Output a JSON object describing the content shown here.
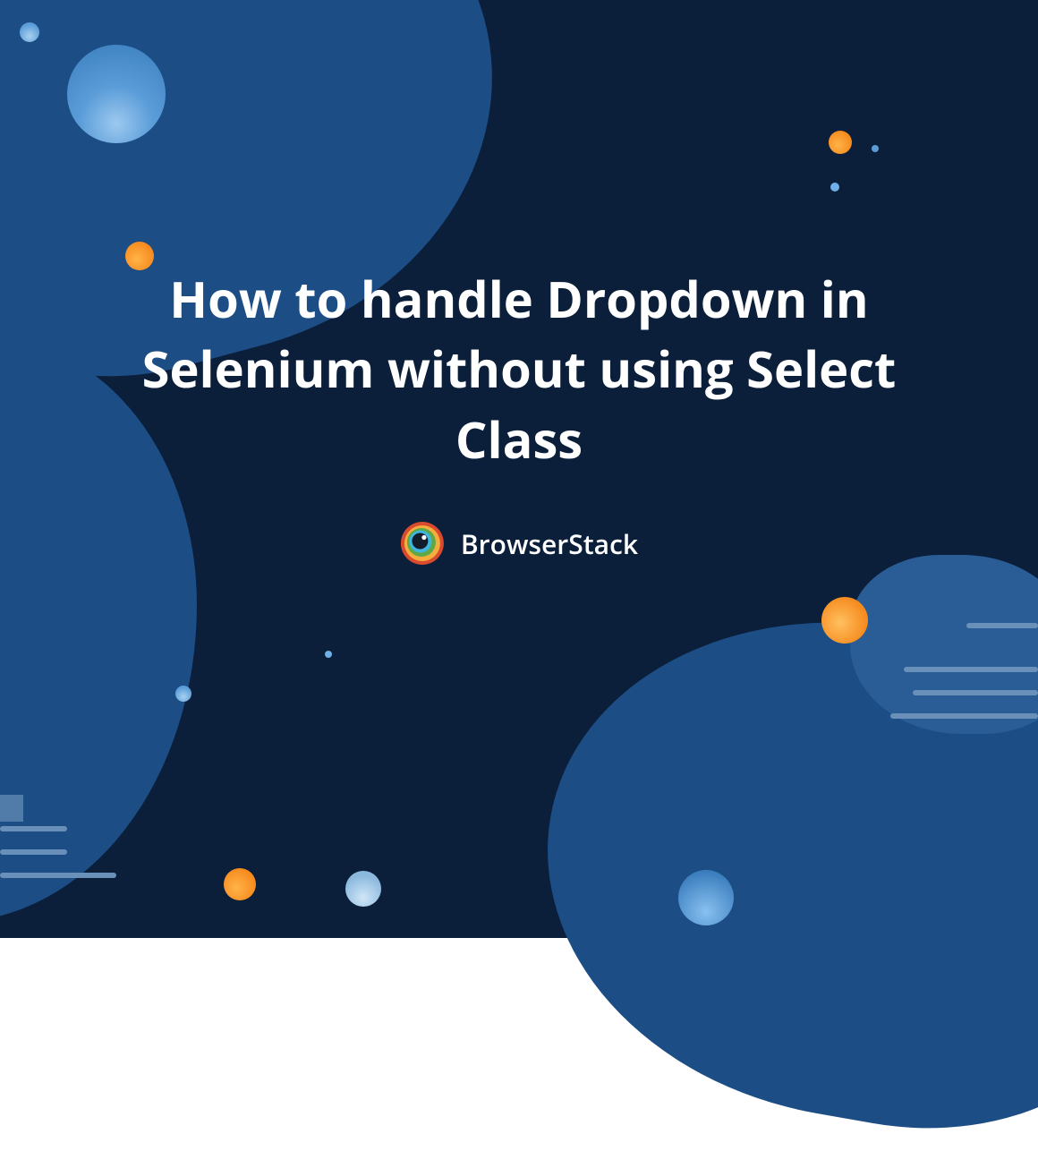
{
  "title": "How to handle Dropdown in Selenium without using Select Class",
  "brand": {
    "name": "BrowserStack"
  },
  "colors": {
    "background_dark": "#0b1e3a",
    "blob_blue": "#1c4d85",
    "accent_orange": "#f68b1f",
    "accent_blue": "#5a9cd8",
    "text": "#ffffff"
  }
}
